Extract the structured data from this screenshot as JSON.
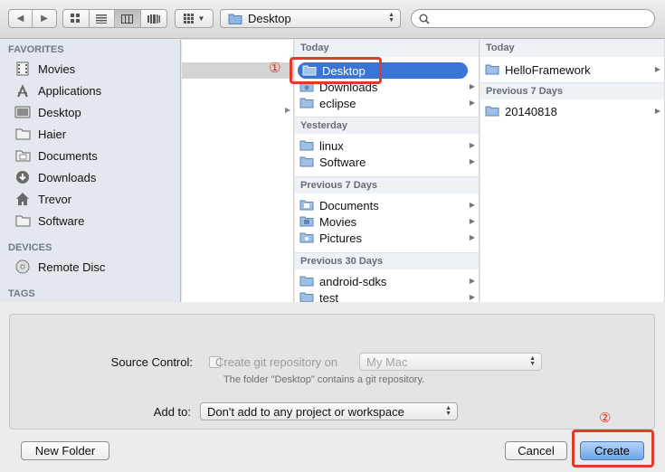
{
  "toolbar": {
    "location": "Desktop",
    "search": {
      "value": "",
      "placeholder": ""
    }
  },
  "sidebar": {
    "favorites_heading": "FAVORITES",
    "favorites": [
      {
        "label": "Movies",
        "icon": "film-icon"
      },
      {
        "label": "Applications",
        "icon": "applications-icon"
      },
      {
        "label": "Desktop",
        "icon": "desktop-icon"
      },
      {
        "label": "Haier",
        "icon": "folder-icon"
      },
      {
        "label": "Documents",
        "icon": "documents-icon"
      },
      {
        "label": "Downloads",
        "icon": "downloads-icon"
      },
      {
        "label": "Trevor",
        "icon": "home-icon"
      },
      {
        "label": "Software",
        "icon": "folder-icon"
      }
    ],
    "devices_heading": "DEVICES",
    "devices": [
      {
        "label": "Remote Disc",
        "icon": "disc-icon"
      }
    ],
    "tags_heading": "TAGS"
  },
  "column2": {
    "groups": [
      {
        "title": "Today",
        "items": [
          "Desktop",
          "Downloads",
          "eclipse"
        ]
      },
      {
        "title": "Yesterday",
        "items": [
          "linux",
          "Software"
        ]
      },
      {
        "title": "Previous 7 Days",
        "items": [
          "Documents",
          "Movies",
          "Pictures"
        ]
      },
      {
        "title": "Previous 30 Days",
        "items": [
          "android-sdks",
          "test"
        ]
      }
    ],
    "selected": "Desktop"
  },
  "column3": {
    "groups": [
      {
        "title": "Today",
        "items": [
          "HelloFramework"
        ]
      },
      {
        "title": "Previous 7 Days",
        "items": [
          "20140818"
        ]
      }
    ]
  },
  "annotations": {
    "marker1": "①",
    "marker2": "②",
    "color": "#e23a28"
  },
  "options": {
    "source_control_label": "Source Control:",
    "create_git_label": "Create git repository on",
    "git_location": "My Mac",
    "git_note": "The folder \"Desktop\" contains a git repository.",
    "add_to_label": "Add to:",
    "add_to_value": "Don't add to any project or workspace"
  },
  "buttons": {
    "new_folder": "New Folder",
    "cancel": "Cancel",
    "create": "Create"
  }
}
